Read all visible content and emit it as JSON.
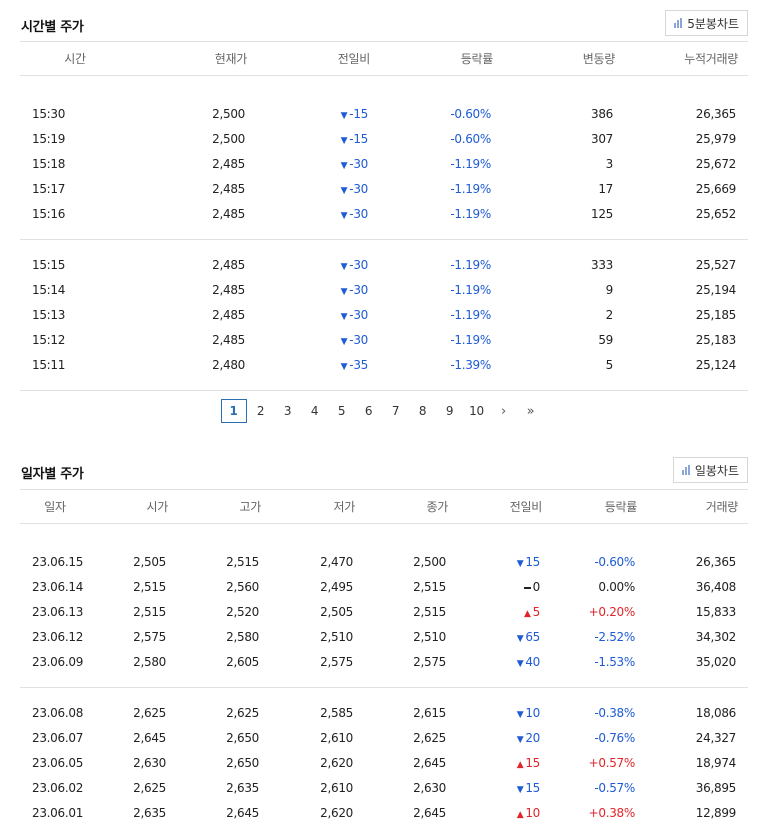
{
  "hourly": {
    "title": "시간별 주가",
    "chart_button": "5분봉차트",
    "headers": [
      "시간",
      "현재가",
      "전일비",
      "등락률",
      "변동량",
      "누적거래량"
    ],
    "group1": [
      {
        "time": "15:30",
        "price": "2,500",
        "diff": "-15",
        "rate": "-0.60%",
        "change": "386",
        "cum": "26,365"
      },
      {
        "time": "15:19",
        "price": "2,500",
        "diff": "-15",
        "rate": "-0.60%",
        "change": "307",
        "cum": "25,979"
      },
      {
        "time": "15:18",
        "price": "2,485",
        "diff": "-30",
        "rate": "-1.19%",
        "change": "3",
        "cum": "25,672"
      },
      {
        "time": "15:17",
        "price": "2,485",
        "diff": "-30",
        "rate": "-1.19%",
        "change": "17",
        "cum": "25,669"
      },
      {
        "time": "15:16",
        "price": "2,485",
        "diff": "-30",
        "rate": "-1.19%",
        "change": "125",
        "cum": "25,652"
      }
    ],
    "group2": [
      {
        "time": "15:15",
        "price": "2,485",
        "diff": "-30",
        "rate": "-1.19%",
        "change": "333",
        "cum": "25,527"
      },
      {
        "time": "15:14",
        "price": "2,485",
        "diff": "-30",
        "rate": "-1.19%",
        "change": "9",
        "cum": "25,194"
      },
      {
        "time": "15:13",
        "price": "2,485",
        "diff": "-30",
        "rate": "-1.19%",
        "change": "2",
        "cum": "25,185"
      },
      {
        "time": "15:12",
        "price": "2,485",
        "diff": "-30",
        "rate": "-1.19%",
        "change": "59",
        "cum": "25,183"
      },
      {
        "time": "15:11",
        "price": "2,480",
        "diff": "-35",
        "rate": "-1.39%",
        "change": "5",
        "cum": "25,124"
      }
    ]
  },
  "pagination": {
    "pages": [
      "1",
      "2",
      "3",
      "4",
      "5",
      "6",
      "7",
      "8",
      "9",
      "10"
    ],
    "current": "1",
    "next": "›",
    "last": "»"
  },
  "daily": {
    "title": "일자별 주가",
    "chart_button": "일봉차트",
    "headers": [
      "일자",
      "시가",
      "고가",
      "저가",
      "종가",
      "전일비",
      "등락률",
      "거래량"
    ],
    "group1": [
      {
        "date": "23.06.15",
        "open": "2,505",
        "high": "2,515",
        "low": "2,470",
        "close": "2,500",
        "dir": "down",
        "diff": "15",
        "rate": "-0.60%",
        "volume": "26,365"
      },
      {
        "date": "23.06.14",
        "open": "2,515",
        "high": "2,560",
        "low": "2,495",
        "close": "2,515",
        "dir": "flat",
        "diff": "0",
        "rate": "0.00%",
        "volume": "36,408"
      },
      {
        "date": "23.06.13",
        "open": "2,515",
        "high": "2,520",
        "low": "2,505",
        "close": "2,515",
        "dir": "up",
        "diff": "5",
        "rate": "+0.20%",
        "volume": "15,833"
      },
      {
        "date": "23.06.12",
        "open": "2,575",
        "high": "2,580",
        "low": "2,510",
        "close": "2,510",
        "dir": "down",
        "diff": "65",
        "rate": "-2.52%",
        "volume": "34,302"
      },
      {
        "date": "23.06.09",
        "open": "2,580",
        "high": "2,605",
        "low": "2,575",
        "close": "2,575",
        "dir": "down",
        "diff": "40",
        "rate": "-1.53%",
        "volume": "35,020"
      }
    ],
    "group2": [
      {
        "date": "23.06.08",
        "open": "2,625",
        "high": "2,625",
        "low": "2,585",
        "close": "2,615",
        "dir": "down",
        "diff": "10",
        "rate": "-0.38%",
        "volume": "18,086"
      },
      {
        "date": "23.06.07",
        "open": "2,645",
        "high": "2,650",
        "low": "2,610",
        "close": "2,625",
        "dir": "down",
        "diff": "20",
        "rate": "-0.76%",
        "volume": "24,327"
      },
      {
        "date": "23.06.05",
        "open": "2,630",
        "high": "2,650",
        "low": "2,620",
        "close": "2,645",
        "dir": "up",
        "diff": "15",
        "rate": "+0.57%",
        "volume": "18,974"
      },
      {
        "date": "23.06.02",
        "open": "2,625",
        "high": "2,635",
        "low": "2,610",
        "close": "2,630",
        "dir": "down",
        "diff": "15",
        "rate": "-0.57%",
        "volume": "36,895"
      },
      {
        "date": "23.06.01",
        "open": "2,635",
        "high": "2,645",
        "low": "2,620",
        "close": "2,645",
        "dir": "up",
        "diff": "10",
        "rate": "+0.38%",
        "volume": "12,899"
      }
    ]
  },
  "colors": {
    "down": "#1e5bd4",
    "up": "#e0262b",
    "pager_active": "#2a6fb0"
  },
  "icons": {
    "chart_button": "bar-chart-icon",
    "down": "triangle-down-icon",
    "up": "triangle-up-icon",
    "flat": "dash-icon"
  }
}
